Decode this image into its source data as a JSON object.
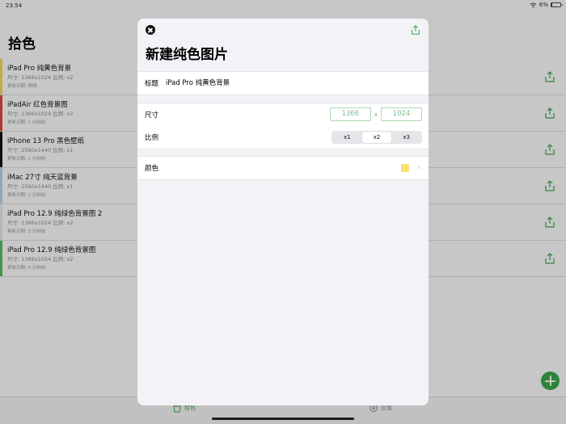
{
  "status_bar": {
    "time": "23:54",
    "battery": "6%",
    "battery_level": 0.06
  },
  "list_page": {
    "title": "拾色",
    "items": [
      {
        "title": "iPad Pro 纯黄色背景",
        "size_line": "尺寸: 1366x1024 比例: x2",
        "date_line": "更新日期: 刚刚",
        "color": "#f6dd62"
      },
      {
        "title": "iPadAir 红色背景图",
        "size_line": "尺寸: 1366x1024 比例: x2",
        "date_line": "更新日期: 1 分钟前",
        "color": "#e5483a"
      },
      {
        "title": "iPhone 13 Pro 黑色壁纸",
        "size_line": "尺寸: 2560x1440 比例: x1",
        "date_line": "更新日期: 1 分钟前",
        "color": "#111111"
      },
      {
        "title": "iMac 27寸 纯天蓝背景",
        "size_line": "尺寸: 2560x1440 比例: x1",
        "date_line": "更新日期: 2 分钟前",
        "color": "#b7d6ef"
      },
      {
        "title": "iPad Pro 12.9 纯绿色背景图 2",
        "size_line": "尺寸: 1366x1024 比例: x2",
        "date_line": "更新日期: 3 分钟前",
        "color": "#e9e9e9"
      },
      {
        "title": "iPad Pro 12.9 纯绿色背景图",
        "size_line": "尺寸: 1366x1024 比例: x2",
        "date_line": "更新日期: 4 分钟前",
        "color": "#5bbf64"
      }
    ]
  },
  "tab_bar": {
    "pick_label": "拾色",
    "settings_label": "设置"
  },
  "sheet": {
    "title": "新建纯色图片",
    "title_field": {
      "label": "标题",
      "value": "iPad Pro 纯黄色背景"
    },
    "size": {
      "label": "尺寸",
      "width": "1366",
      "separator": "x",
      "height": "1024"
    },
    "scale": {
      "label": "比例",
      "options": [
        "x1",
        "x2",
        "x3"
      ],
      "selected": "x2"
    },
    "color": {
      "label": "颜色",
      "value": "#f7e270"
    }
  },
  "colors": {
    "accent": "#3aa94a"
  }
}
